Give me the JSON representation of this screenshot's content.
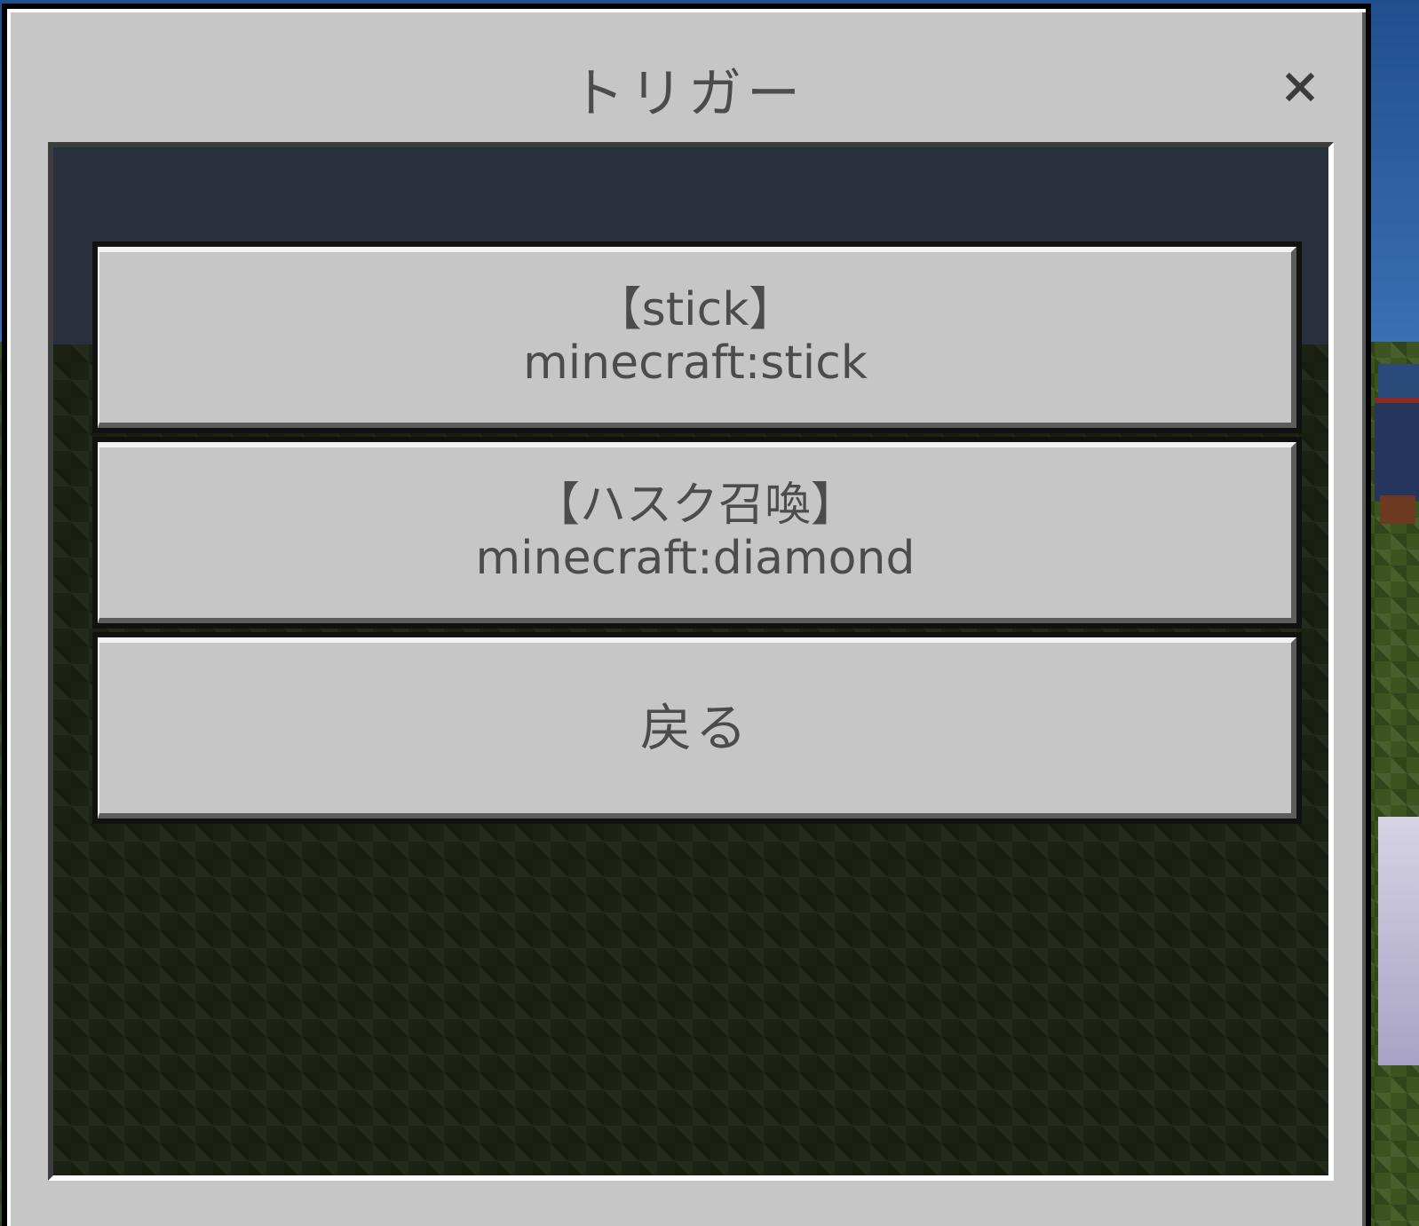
{
  "dialog": {
    "title": "トリガー",
    "close_icon": "close-icon"
  },
  "buttons": [
    {
      "name": "【stick】",
      "id": "minecraft:stick"
    },
    {
      "name": "【ハスク召喚】",
      "id": "minecraft:diamond"
    }
  ],
  "back_button": {
    "label": "戻る"
  }
}
